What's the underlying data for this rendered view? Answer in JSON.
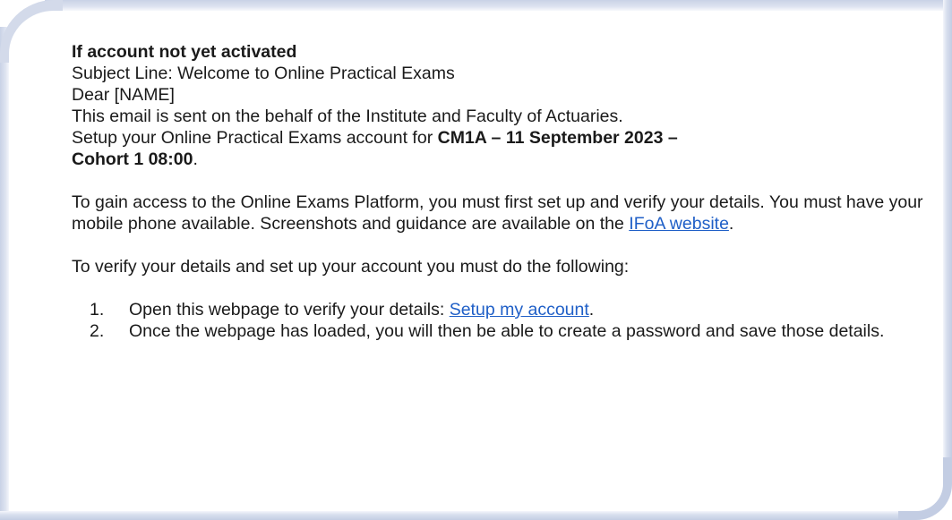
{
  "email": {
    "heading": "If account not yet activated",
    "subject": "Subject Line: Welcome to Online Practical Exams",
    "greeting": "Dear [NAME]",
    "sent_on_behalf": "This email is sent on the behalf of the Institute and Faculty of Actuaries.",
    "setup_prefix": "Setup your Online Practical Exams account for ",
    "exam_bold_line1": "CM1A – 11 September 2023 –",
    "exam_bold_line2": "Cohort 1 08:00",
    "exam_suffix": ".",
    "access_text": "To gain access to the Online Exams Platform, you must first set up and verify your details. You must have your mobile phone available. Screenshots and guidance are available on the ",
    "ifoa_link": "IFoA website",
    "access_suffix": ".",
    "verify_intro": "To verify your details and set up your account you must do the following:",
    "steps": [
      {
        "num": "1.",
        "text": "Open this webpage to verify your details: ",
        "link": "Setup my account",
        "suffix": "."
      },
      {
        "num": "2.",
        "text": "Once the webpage has loaded, you will then be able to create a password and save those details."
      }
    ]
  }
}
